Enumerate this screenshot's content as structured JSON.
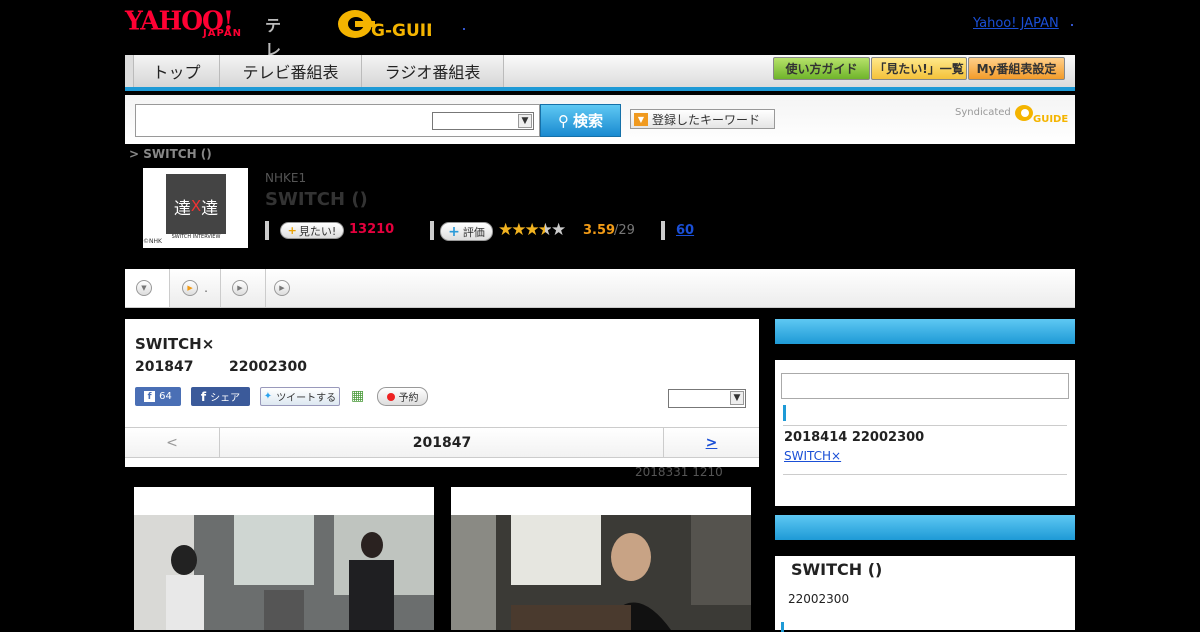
{
  "header": {
    "logo_yahoo": "YAHOO!",
    "logo_japan": "JAPAN",
    "logo_tv": "テレビ",
    "logo_gguide": "G-GUIDE",
    "yahoo_japan_link": "Yahoo! JAPAN"
  },
  "nav": {
    "tabs": [
      "トップ",
      "テレビ番組表",
      "ラジオ番組表"
    ],
    "buttons": [
      "使い方ガイド",
      "「見たい!」一覧",
      "My番組表設定"
    ]
  },
  "search": {
    "input_value": "",
    "select_value": "",
    "button_label": "検索",
    "keyword_button": "登録したキーワード",
    "syndicated": "Syndicated"
  },
  "program": {
    "breadcrumb": "> SWITCH ()",
    "channel": "NHKE1",
    "title": "SWITCH ()",
    "thumb_text_left": "達",
    "thumb_text_x": "X",
    "thumb_text_right": "達",
    "thumb_caption": "SWITCH INTERVIEW",
    "thumb_credit": "©NHK",
    "mitai_label": "見たい!",
    "mitai_count": "13210",
    "rate_label": "評価",
    "rating": 3.59,
    "rating_text": "3.59",
    "rating_count": "/29",
    "review_link": "60"
  },
  "tabs": {
    "items": [
      "",
      ".",
      "",
      ""
    ]
  },
  "main": {
    "title": "SWITCH×",
    "date": "201847",
    "time": "22002300",
    "fb_like_count": "64",
    "fb_share_label": "シェア",
    "tweet_label": "ツイートする",
    "reserve_label": "予約",
    "select_value": "",
    "pager_prev": "<",
    "pager_current": "201847",
    "pager_next": ">",
    "updated": "2018331  1210"
  },
  "sidebar": {
    "search_value": "",
    "entry_date": "2018414  22002300",
    "entry_link": "SWITCH×",
    "section2_title": "SWITCH ()",
    "section2_time": "22002300"
  },
  "colors": {
    "accent_blue": "#1e9ad6",
    "mitai_red": "#e4003d",
    "rating_orange": "#f29b16",
    "link_blue": "#1a4fd6"
  }
}
